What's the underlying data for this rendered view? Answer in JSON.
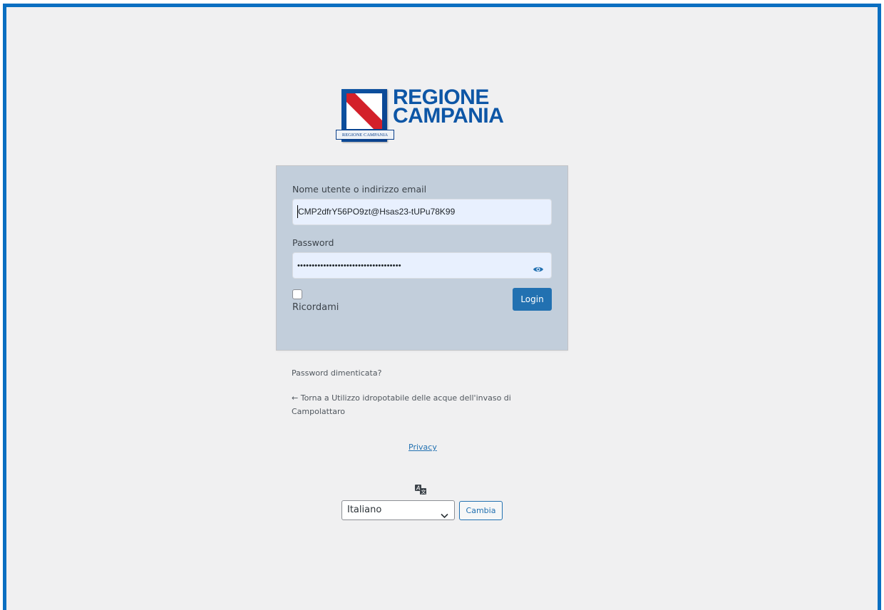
{
  "logo": {
    "line1": "REGIONE",
    "line2": "CAMPANIA",
    "caption": "REGIONE CAMPANIA",
    "brand_color": "#0d56a6"
  },
  "form": {
    "username_label": "Nome utente o indirizzo email",
    "username_value": "CMP2dfrY56PO9zt@Hsas23-tUPu78K99",
    "password_label": "Password",
    "password_value": "••••••••••••••••••••••••••••••••••••",
    "password_toggle_icon": "eye-icon",
    "remember_label": "Ricordami",
    "remember_checked": false,
    "login_label": "Login"
  },
  "links": {
    "lost_password": "Password dimenticata?",
    "back_to_site": "← Torna a Utilizzo idropotabile delle acque dell'invaso di Campolattaro",
    "privacy": "Privacy"
  },
  "language": {
    "icon": "translate-icon",
    "selected": "Italiano",
    "change_label": "Cambia"
  },
  "colors": {
    "accent": "#2271b1",
    "frame": "#0a6fc1",
    "box_background": "#c2cedb",
    "field_background": "#e8f0fe"
  }
}
